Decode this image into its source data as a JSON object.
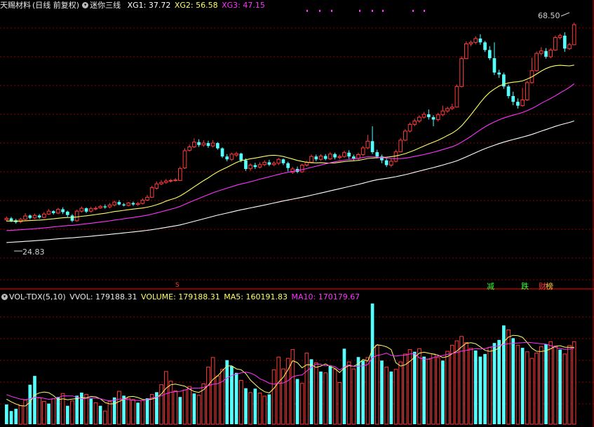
{
  "header_top": {
    "stock_name": "天赐材料",
    "period": "(日线 前复权)",
    "indicator_name": "迷你三线",
    "xg1_label": "XG1: 37.72",
    "xg2_label": "XG2: 56.58",
    "xg3_label": "XG3: 47.15"
  },
  "header_bottom": {
    "indicator": "VOL-TDX(5,10)",
    "vvol": "VVOL: 179188.31",
    "volume": "VOLUME: 179188.31",
    "ma5": "MA5: 160191.83",
    "ma10": "MA10: 170179.67"
  },
  "markers": {
    "high_label": "68.50",
    "low_label": "24.83",
    "s_marker": "S",
    "event_1": "减",
    "event_2": "跌",
    "event_3": "财",
    "event_4": "榜"
  },
  "colors": {
    "up": "#ff3b3b",
    "down": "#54ffff",
    "line_yellow": "#ffff66",
    "line_magenta": "#ff33ff",
    "line_white": "#ffffff",
    "grid": "#8b0000"
  },
  "chart_data": {
    "type": "candlestick",
    "price_range": [
      21.0,
      71.0
    ],
    "candles": [
      [
        27.8,
        28.1,
        28.5,
        27.4
      ],
      [
        28.1,
        27.6,
        28.4,
        27.3
      ],
      [
        27.7,
        27.3,
        28.0,
        27.0
      ],
      [
        27.4,
        27.9,
        28.2,
        27.1
      ],
      [
        27.9,
        28.6,
        29.2,
        27.7
      ],
      [
        28.7,
        28.2,
        28.9,
        27.9
      ],
      [
        28.2,
        28.7,
        29.1,
        28.0
      ],
      [
        28.7,
        28.3,
        29.0,
        28.0
      ],
      [
        28.3,
        29.0,
        29.4,
        28.1
      ],
      [
        29.0,
        29.6,
        30.0,
        28.8
      ],
      [
        29.6,
        29.2,
        29.8,
        28.9
      ],
      [
        29.2,
        30.0,
        30.3,
        29.0
      ],
      [
        30.0,
        29.4,
        30.4,
        29.0
      ],
      [
        29.5,
        28.8,
        29.7,
        28.4
      ],
      [
        28.7,
        27.6,
        29.0,
        27.3
      ],
      [
        27.6,
        29.6,
        29.9,
        27.4
      ],
      [
        29.6,
        30.2,
        30.6,
        29.3
      ],
      [
        30.2,
        29.5,
        30.4,
        29.2
      ],
      [
        29.6,
        30.1,
        30.5,
        29.3
      ],
      [
        30.1,
        30.2,
        30.6,
        29.8
      ],
      [
        30.3,
        30.6,
        30.9,
        30.1
      ],
      [
        30.6,
        30.4,
        31.0,
        30.1
      ],
      [
        30.5,
        30.9,
        31.3,
        30.2
      ],
      [
        30.9,
        31.5,
        31.8,
        30.6
      ],
      [
        31.5,
        31.0,
        31.9,
        30.8
      ],
      [
        31.0,
        30.8,
        31.3,
        30.6
      ],
      [
        30.8,
        31.3,
        31.5,
        30.6
      ],
      [
        31.3,
        31.0,
        31.6,
        30.7
      ],
      [
        31.0,
        31.2,
        31.5,
        30.7
      ],
      [
        31.2,
        31.9,
        32.3,
        31.0
      ],
      [
        31.9,
        32.5,
        33.0,
        31.7
      ],
      [
        32.5,
        34.5,
        34.9,
        32.4
      ],
      [
        34.4,
        35.3,
        35.8,
        34.1
      ],
      [
        35.3,
        35.6,
        36.1,
        35.0
      ],
      [
        35.6,
        35.9,
        36.3,
        35.3
      ],
      [
        35.9,
        36.0,
        36.3,
        35.6
      ],
      [
        36.0,
        36.1,
        36.5,
        35.8
      ],
      [
        36.0,
        38.5,
        38.9,
        35.9
      ],
      [
        38.6,
        42.2,
        42.7,
        38.4
      ],
      [
        42.3,
        43.0,
        43.5,
        42.0
      ],
      [
        43.0,
        44.0,
        44.8,
        42.8
      ],
      [
        44.0,
        43.4,
        44.6,
        43.0
      ],
      [
        43.4,
        43.8,
        44.4,
        43.0
      ],
      [
        43.8,
        43.2,
        44.3,
        42.8
      ],
      [
        43.2,
        43.8,
        44.4,
        42.9
      ],
      [
        43.8,
        42.7,
        44.0,
        42.4
      ],
      [
        42.7,
        41.0,
        42.9,
        40.7
      ],
      [
        41.0,
        40.4,
        41.5,
        40.0
      ],
      [
        40.4,
        41.5,
        41.8,
        40.1
      ],
      [
        41.3,
        41.6,
        42.0,
        40.9
      ],
      [
        41.6,
        40.2,
        41.8,
        39.8
      ],
      [
        40.2,
        38.4,
        40.6,
        38.0
      ],
      [
        38.5,
        39.2,
        39.6,
        38.0
      ],
      [
        39.2,
        38.8,
        39.7,
        38.4
      ],
      [
        38.8,
        39.3,
        39.8,
        38.5
      ],
      [
        39.3,
        39.8,
        40.2,
        39.0
      ],
      [
        39.8,
        39.3,
        40.3,
        39.0
      ],
      [
        39.3,
        39.6,
        40.0,
        39.0
      ],
      [
        39.6,
        40.4,
        40.7,
        39.2
      ],
      [
        40.4,
        39.6,
        40.6,
        39.2
      ],
      [
        39.6,
        38.6,
        39.9,
        37.9
      ],
      [
        37.7,
        38.4,
        38.8,
        37.4
      ],
      [
        38.4,
        37.8,
        38.9,
        37.5
      ],
      [
        37.8,
        39.2,
        39.5,
        37.6
      ],
      [
        39.2,
        39.8,
        40.1,
        38.9
      ],
      [
        39.8,
        41.0,
        41.4,
        39.6
      ],
      [
        41.0,
        40.4,
        41.4,
        40.0
      ],
      [
        40.4,
        41.1,
        41.5,
        40.1
      ],
      [
        41.1,
        40.5,
        41.5,
        40.2
      ],
      [
        40.5,
        41.5,
        41.9,
        40.3
      ],
      [
        41.5,
        40.8,
        41.8,
        40.4
      ],
      [
        40.8,
        41.0,
        41.4,
        40.4
      ],
      [
        41.0,
        41.8,
        42.2,
        40.7
      ],
      [
        41.8,
        41.0,
        42.3,
        40.5
      ],
      [
        41.0,
        40.6,
        41.4,
        40.2
      ],
      [
        40.6,
        41.4,
        41.8,
        40.3
      ],
      [
        41.4,
        42.8,
        43.2,
        41.1
      ],
      [
        42.8,
        44.2,
        45.5,
        42.5
      ],
      [
        44.2,
        41.9,
        47.3,
        41.5
      ],
      [
        41.9,
        41.0,
        42.4,
        40.6
      ],
      [
        41.0,
        40.2,
        41.4,
        39.6
      ],
      [
        40.2,
        39.2,
        40.6,
        38.8
      ],
      [
        39.2,
        40.0,
        40.6,
        38.8
      ],
      [
        40.0,
        42.0,
        42.4,
        39.8
      ],
      [
        42.0,
        44.4,
        44.8,
        41.9
      ],
      [
        44.4,
        46.3,
        46.7,
        44.2
      ],
      [
        46.3,
        47.7,
        48.1,
        46.0
      ],
      [
        47.7,
        48.4,
        48.9,
        47.3
      ],
      [
        48.4,
        49.2,
        49.6,
        48.0
      ],
      [
        49.2,
        49.8,
        50.3,
        48.9
      ],
      [
        49.8,
        49.2,
        50.8,
        48.7
      ],
      [
        49.2,
        48.7,
        49.6,
        47.3
      ],
      [
        48.7,
        49.7,
        50.1,
        48.3
      ],
      [
        49.7,
        50.5,
        51.6,
        49.4
      ],
      [
        50.5,
        51.0,
        51.4,
        50.1
      ],
      [
        51.0,
        51.3,
        52.0,
        50.7
      ],
      [
        51.3,
        55.6,
        56.0,
        51.2
      ],
      [
        55.6,
        61.4,
        61.9,
        55.4
      ],
      [
        61.4,
        64.5,
        65.0,
        61.3
      ],
      [
        64.5,
        64.8,
        65.2,
        64.0
      ],
      [
        64.8,
        65.6,
        66.1,
        64.4
      ],
      [
        65.6,
        64.8,
        66.5,
        64.3
      ],
      [
        64.8,
        63.2,
        65.1,
        62.8
      ],
      [
        63.2,
        61.5,
        64.0,
        61.1
      ],
      [
        61.5,
        58.5,
        64.8,
        58.0
      ],
      [
        58.5,
        58.1,
        59.1,
        57.4
      ],
      [
        58.1,
        55.6,
        58.5,
        55.1
      ],
      [
        55.6,
        53.6,
        56.0,
        53.1
      ],
      [
        53.6,
        52.4,
        54.5,
        51.7
      ],
      [
        52.4,
        51.6,
        53.1,
        51.0
      ],
      [
        51.6,
        52.8,
        55.3,
        51.4
      ],
      [
        52.8,
        56.4,
        56.8,
        52.6
      ],
      [
        56.4,
        58.9,
        61.6,
        56.2
      ],
      [
        58.9,
        62.5,
        62.9,
        58.7
      ],
      [
        62.5,
        63.0,
        63.8,
        62.1
      ],
      [
        63.0,
        61.8,
        63.6,
        61.4
      ],
      [
        61.8,
        63.2,
        63.6,
        61.5
      ],
      [
        63.2,
        65.8,
        66.2,
        63.0
      ],
      [
        65.8,
        66.2,
        66.6,
        65.4
      ],
      [
        66.2,
        63.5,
        66.9,
        62.8
      ],
      [
        63.5,
        64.3,
        64.7,
        63.2
      ],
      [
        64.3,
        68.5,
        68.9,
        64.2
      ]
    ],
    "volume_range": [
      0,
      270000
    ],
    "volumes": [
      [
        45000,
        0
      ],
      [
        30000,
        0
      ],
      [
        35000,
        0
      ],
      [
        42000,
        1
      ],
      [
        55000,
        1
      ],
      [
        90000,
        0
      ],
      [
        110000,
        0
      ],
      [
        60000,
        1
      ],
      [
        52000,
        1
      ],
      [
        47000,
        0
      ],
      [
        58000,
        1
      ],
      [
        62000,
        0
      ],
      [
        70000,
        1
      ],
      [
        42000,
        0
      ],
      [
        53000,
        1
      ],
      [
        65000,
        0
      ],
      [
        72000,
        0
      ],
      [
        68000,
        1
      ],
      [
        58000,
        0
      ],
      [
        49000,
        1
      ],
      [
        42000,
        0
      ],
      [
        30000,
        1
      ],
      [
        52000,
        1
      ],
      [
        61000,
        0
      ],
      [
        75000,
        1
      ],
      [
        65000,
        0
      ],
      [
        59000,
        1
      ],
      [
        56000,
        1
      ],
      [
        49000,
        0
      ],
      [
        54000,
        1
      ],
      [
        59000,
        0
      ],
      [
        68000,
        1
      ],
      [
        73000,
        0
      ],
      [
        90000,
        1
      ],
      [
        120000,
        1
      ],
      [
        98000,
        1
      ],
      [
        76000,
        1
      ],
      [
        62000,
        0
      ],
      [
        78000,
        1
      ],
      [
        86000,
        1
      ],
      [
        70000,
        0
      ],
      [
        66000,
        1
      ],
      [
        92000,
        1
      ],
      [
        130000,
        1
      ],
      [
        152000,
        1
      ],
      [
        110000,
        1
      ],
      [
        125000,
        1
      ],
      [
        146000,
        0
      ],
      [
        132000,
        0
      ],
      [
        117000,
        0
      ],
      [
        100000,
        1
      ],
      [
        82000,
        0
      ],
      [
        72000,
        1
      ],
      [
        81000,
        0
      ],
      [
        71000,
        1
      ],
      [
        64000,
        1
      ],
      [
        68000,
        0
      ],
      [
        124000,
        1
      ],
      [
        153000,
        1
      ],
      [
        126000,
        1
      ],
      [
        150000,
        1
      ],
      [
        170000,
        1
      ],
      [
        103000,
        0
      ],
      [
        93000,
        1
      ],
      [
        162000,
        1
      ],
      [
        148000,
        0
      ],
      [
        140000,
        1
      ],
      [
        120000,
        0
      ],
      [
        117000,
        1
      ],
      [
        132000,
        0
      ],
      [
        125000,
        1
      ],
      [
        95000,
        1
      ],
      [
        172000,
        0
      ],
      [
        142000,
        1
      ],
      [
        126000,
        1
      ],
      [
        153000,
        0
      ],
      [
        145000,
        0
      ],
      [
        152000,
        1
      ],
      [
        275000,
        0
      ],
      [
        180000,
        1
      ],
      [
        145000,
        0
      ],
      [
        130000,
        1
      ],
      [
        120000,
        0
      ],
      [
        125000,
        1
      ],
      [
        142000,
        1
      ],
      [
        160000,
        1
      ],
      [
        170000,
        1
      ],
      [
        165000,
        0
      ],
      [
        172000,
        1
      ],
      [
        154000,
        0
      ],
      [
        148000,
        1
      ],
      [
        160000,
        1
      ],
      [
        152000,
        1
      ],
      [
        145000,
        0
      ],
      [
        166000,
        1
      ],
      [
        180000,
        1
      ],
      [
        190000,
        1
      ],
      [
        200000,
        1
      ],
      [
        186000,
        1
      ],
      [
        173000,
        1
      ],
      [
        168000,
        0
      ],
      [
        154000,
        0
      ],
      [
        160000,
        0
      ],
      [
        175000,
        1
      ],
      [
        185000,
        0
      ],
      [
        192000,
        0
      ],
      [
        225000,
        0
      ],
      [
        215000,
        1
      ],
      [
        196000,
        0
      ],
      [
        180000,
        1
      ],
      [
        174000,
        0
      ],
      [
        165000,
        1
      ],
      [
        150000,
        1
      ],
      [
        162000,
        1
      ],
      [
        177000,
        1
      ],
      [
        182000,
        0
      ],
      [
        188000,
        1
      ],
      [
        178000,
        1
      ],
      [
        170000,
        0
      ],
      [
        160000,
        1
      ],
      [
        179188,
        1
      ],
      [
        188000,
        1
      ]
    ]
  }
}
